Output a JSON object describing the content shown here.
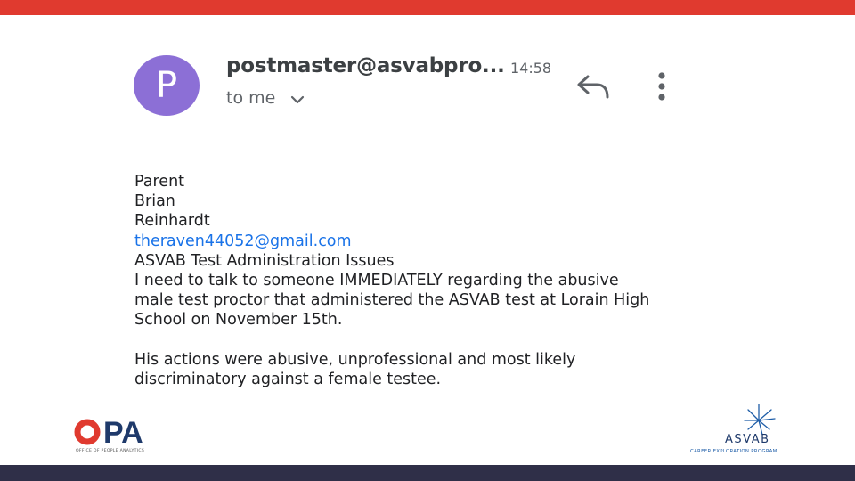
{
  "colors": {
    "top_bar": "#e03a2f",
    "bottom_bar": "#2f2f48",
    "avatar_bg": "#8c6fd6",
    "link": "#1a73e8",
    "opa_red": "#e03a2f",
    "opa_navy": "#1f3a6b",
    "asvab_navy": "#1f3a6b"
  },
  "email": {
    "avatar_letter": "P",
    "sender": "postmaster@asvabpro...",
    "time": "14:58",
    "recipient": "to me",
    "icons": {
      "recipient_details": "chevron-down-icon",
      "reply": "reply-icon",
      "more": "more-vertical-icon"
    },
    "body": {
      "line1": "Parent",
      "line2": "Brian",
      "line3": "Reinhardt",
      "email_link": "theraven44052@gmail.com",
      "subject": "ASVAB Test Administration Issues",
      "para1_line1": "I need to talk to someone IMMEDIATELY regarding the abusive",
      "para1_line2": "male test proctor that administered the ASVAB test at Lorain High",
      "para1_line3": "School on November 15th.",
      "para2_line1": "His actions were abusive, unprofessional and most likely",
      "para2_line2": "discriminatory against a female testee."
    }
  },
  "logos": {
    "opa": {
      "wordmark": "OPA",
      "tagline": "OFFICE OF PEOPLE ANALYTICS"
    },
    "asvab": {
      "name": "ASVAB",
      "subtitle": "CAREER EXPLORATION PROGRAM"
    }
  }
}
